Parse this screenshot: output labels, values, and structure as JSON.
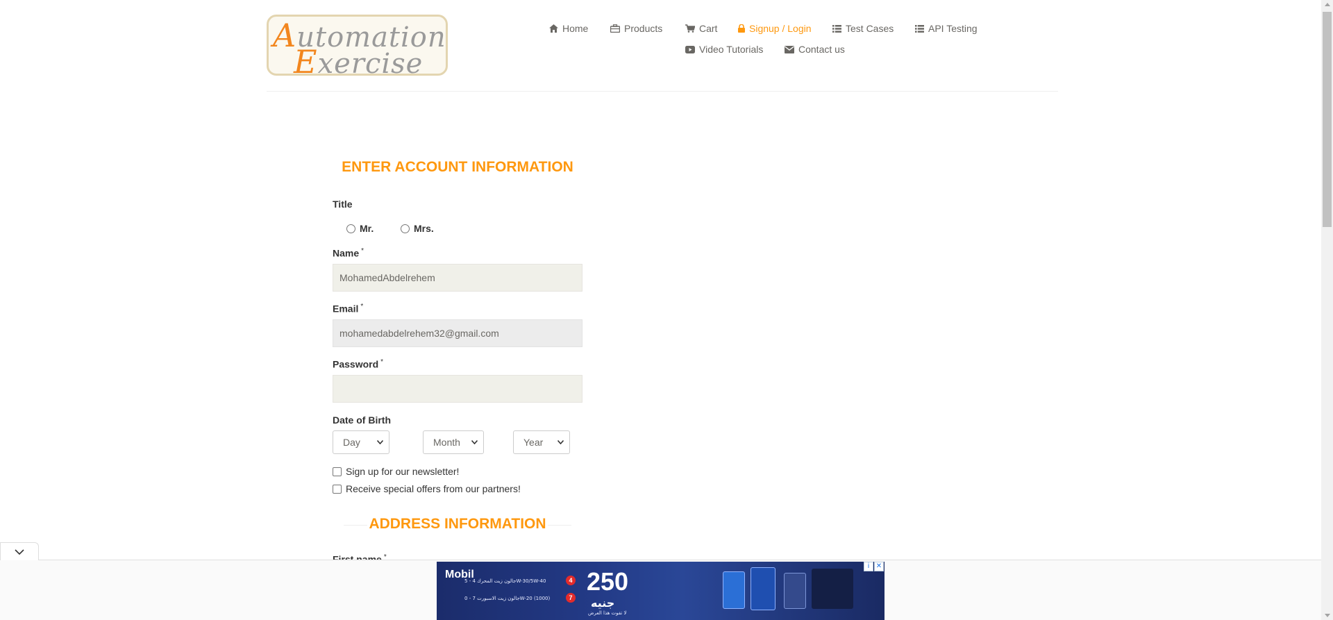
{
  "logo": {
    "line1_cap": "A",
    "line1_rest": "utomation",
    "line2_cap": "E",
    "line2_rest": "xercise"
  },
  "nav": {
    "home": "Home",
    "products": "Products",
    "cart": "Cart",
    "signup_login": "Signup / Login",
    "test_cases": "Test Cases",
    "api_testing": "API Testing",
    "video_tutorials": "Video Tutorials",
    "contact_us": "Contact us"
  },
  "form": {
    "heading": "ENTER ACCOUNT INFORMATION",
    "title_label": "Title",
    "title_options": [
      "Mr.",
      "Mrs."
    ],
    "name_label": "Name",
    "name_value": "MohamedAbdelrehem",
    "email_label": "Email",
    "email_value": "mohamedabdelrehem32@gmail.com",
    "password_label": "Password",
    "password_value": "",
    "required_mark": "*",
    "dob_label": "Date of Birth",
    "dob_day": "Day",
    "dob_month": "Month",
    "dob_year": "Year",
    "newsletter_label": "Sign up for our newsletter!",
    "offers_label": "Receive special offers from our partners!",
    "address_heading": "ADDRESS INFORMATION",
    "first_name_label": "First name"
  },
  "ad": {
    "brand": "Mobil",
    "big_number": "250",
    "currency_word": "جنيه",
    "badge_a": "4",
    "badge_b": "7",
    "line_a": "جالون زيت المحرك 4 - 5W-30/5W-40",
    "line_b": "جالون زيت الاسبورت 7 - 0W-20 (1000)",
    "line_c": "لا تفوت هذا العرض",
    "info_symbol": "i",
    "close_symbol": "✕"
  },
  "colors": {
    "accent": "#fe980f",
    "nav_text": "#696763",
    "field_bg": "#f0f0e9"
  }
}
